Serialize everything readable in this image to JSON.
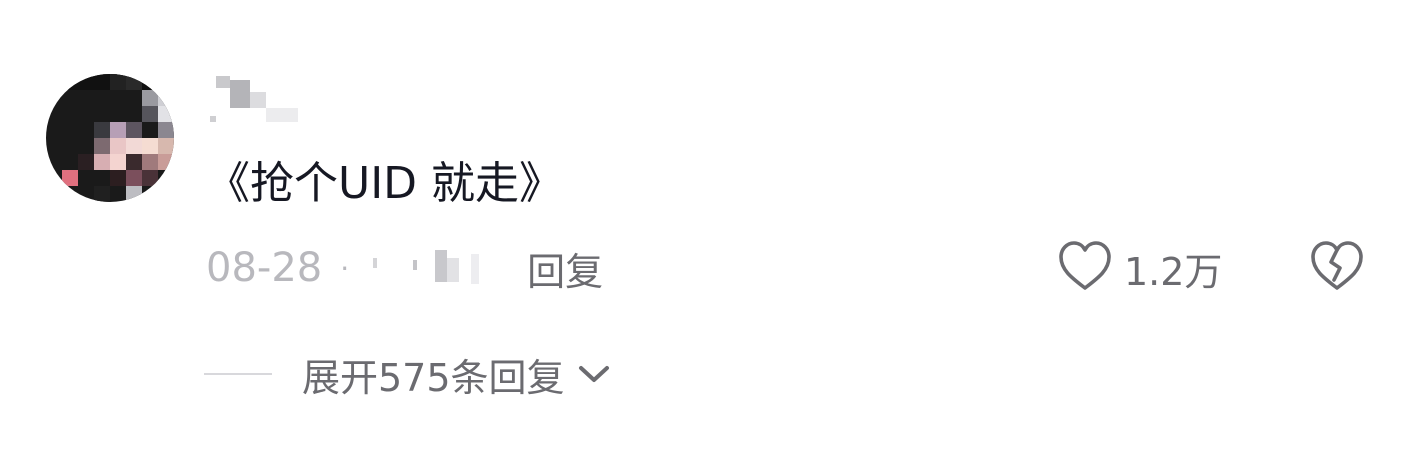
{
  "comment": {
    "text": "《抢个UID 就走》",
    "timestamp": "08-28",
    "separator": "·",
    "reply_label": "回复",
    "like_count": "1.2万",
    "expand_label": "展开575条回复"
  },
  "icons": {
    "like": "heart-outline-icon",
    "dislike": "broken-heart-icon",
    "expand": "chevron-down-icon"
  },
  "colors": {
    "primary_text": "#161823",
    "secondary_text": "#6b6b70",
    "timestamp_text": "#b8b8bd",
    "divider": "#d8d8dc"
  }
}
